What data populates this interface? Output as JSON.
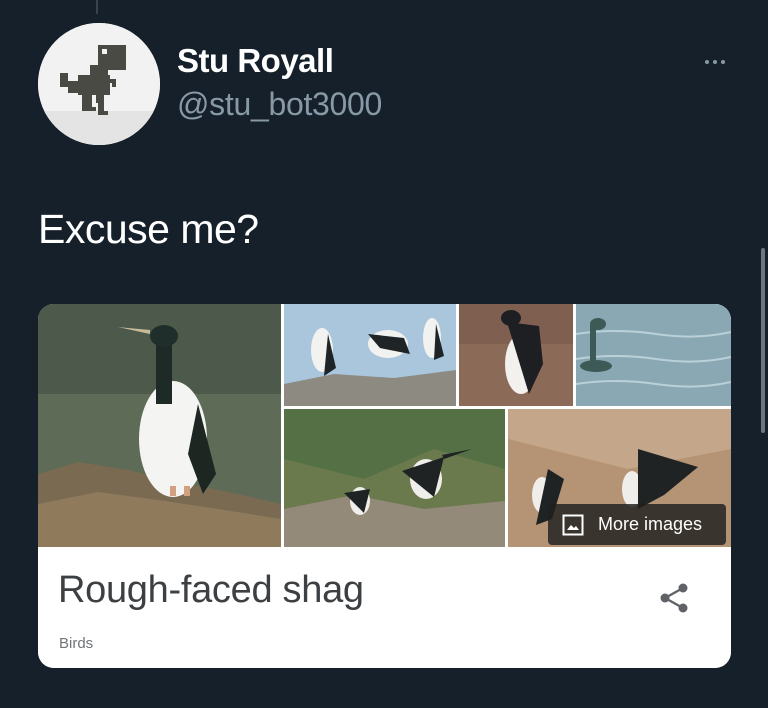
{
  "tweet": {
    "author_name": "Stu Royall",
    "author_handle": "@stu_bot3000",
    "text": "Excuse me?"
  },
  "card": {
    "title": "Rough-faced shag",
    "subtitle": "Birds",
    "more_images_label": "More images"
  },
  "icons": {
    "avatar": "pixel-dinosaur",
    "more": "horizontal-ellipsis-icon",
    "image": "image-icon",
    "share": "share-icon"
  },
  "colors": {
    "background": "#15202b",
    "secondary_text": "#8899a6",
    "card_title": "#3c4043",
    "card_subtitle": "#70757a"
  }
}
